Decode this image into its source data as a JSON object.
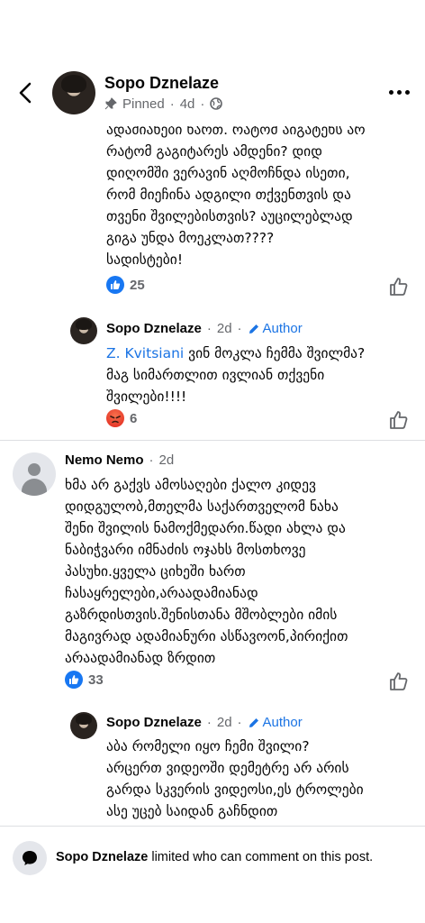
{
  "header": {
    "name": "Sopo Dznelaze",
    "pinned": "Pinned",
    "dot": "·",
    "age": "4d",
    "icons": [
      "back-chevron-icon",
      "pin-icon",
      "globe-icon",
      "more-dots-icon"
    ]
  },
  "comments": [
    {
      "text": "ადამიანები ხართ. რატომ აიგატეხს არ\nრატომ გაგიტარეს ამდენი? დიდ\nდიღომში ვერავინ აღმოჩნდა ისეთი,\nრომ მიეჩინა ადგილი თქვენთვის და\nთვენი შვილებისთვის? აუცილებლად\nგიგა უნდა მოეკლათ????\nსადისტები!",
      "reaction_count": "25"
    },
    {
      "author": "Sopo Dznelaze",
      "time": "2d",
      "author_tag": "Author",
      "mention": "Z. Kvitsiani",
      "text": " ვინ მოკლა ჩემმა შვილმა?\nმაგ სიმართლით ივლიან თქვენი\nშვილები!!!!",
      "reaction_count": "6"
    },
    {
      "author": "Nemo Nemo",
      "time": "2d",
      "text": "ხმა არ გაქვს ამოსაღები ქალო კიდევ\nდიდგულობ,მთელმა საქართველომ ნახა\nშენი შვილის ნამოქმედარი.წადი ახლა და\nნაბიჭვარი იმნაძის ოჯახს მოსთხოვე\nპასუხი.ყველა ციხეში ხართ\nჩასაყრელები,არაადამიანად\nგაზრდისთვის.შენისთანა მშობლები იმის\nმაგივრად ადამიანური ასწავოონ,პირიქით\nარაადამიანად ზრდით",
      "reaction_count": "33"
    },
    {
      "author": "Sopo Dznelaze",
      "time": "2d",
      "author_tag": "Author",
      "text": "აბა რომელი იყო ჩემი შვილი?\nარცერთ ვიდეოში დემეტრე არ არის\nგარდა სკვერის ვიდეოსი,ეს ტროლები\nასე უცებ საიდან გაჩნდით"
    }
  ],
  "footer": {
    "name": "Sopo Dznelaze",
    "message": " limited who can comment on this post."
  },
  "colors": {
    "link_blue": "#1b74e4",
    "like_blue": "#1877f2",
    "meta_gray": "#65676b",
    "angry_red": "#e0241c"
  }
}
